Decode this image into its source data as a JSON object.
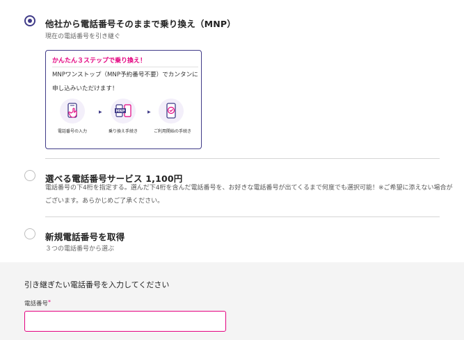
{
  "options": [
    {
      "title": "他社から電話番号そのままで乗り換え（MNP）",
      "subtitle": "現在の電話番号を引き継ぐ",
      "selected": true
    },
    {
      "title": "選べる電話番号サービス 1,100円",
      "description": "電話番号の下4桁を指定する。選んだ下4桁を含んだ電話番号を、お好きな電話番号が出てくるまで何度でも選択可能！※ご希望に添えない場合がございます。あらかじめご了承ください。",
      "selected": false
    },
    {
      "title": "新規電話番号を取得",
      "subtitle": "３つの電話番号から選ぶ",
      "selected": false
    }
  ],
  "mnp_card": {
    "heading": "かんたん３ステップで乗り換え！",
    "body": "MNPワンストップ（MNP予約番号不要）でカンタンに申し込みいただけます！",
    "steps": [
      {
        "label": "電話番号の入力",
        "icon": "phone-tap-icon"
      },
      {
        "label": "乗り換え手続き",
        "icon": "mnp-transfer-icon"
      },
      {
        "label": "ご利用開始の手続き",
        "icon": "check-phone-icon"
      }
    ]
  },
  "form": {
    "title": "引き継ぎたい電話番号を入力してください",
    "field_label": "電話番号",
    "required_mark": "*",
    "value": "",
    "placeholder": ""
  },
  "colors": {
    "primary": "#3f3a87",
    "accent": "#e4007f",
    "form_bg": "#f4f4f4"
  }
}
